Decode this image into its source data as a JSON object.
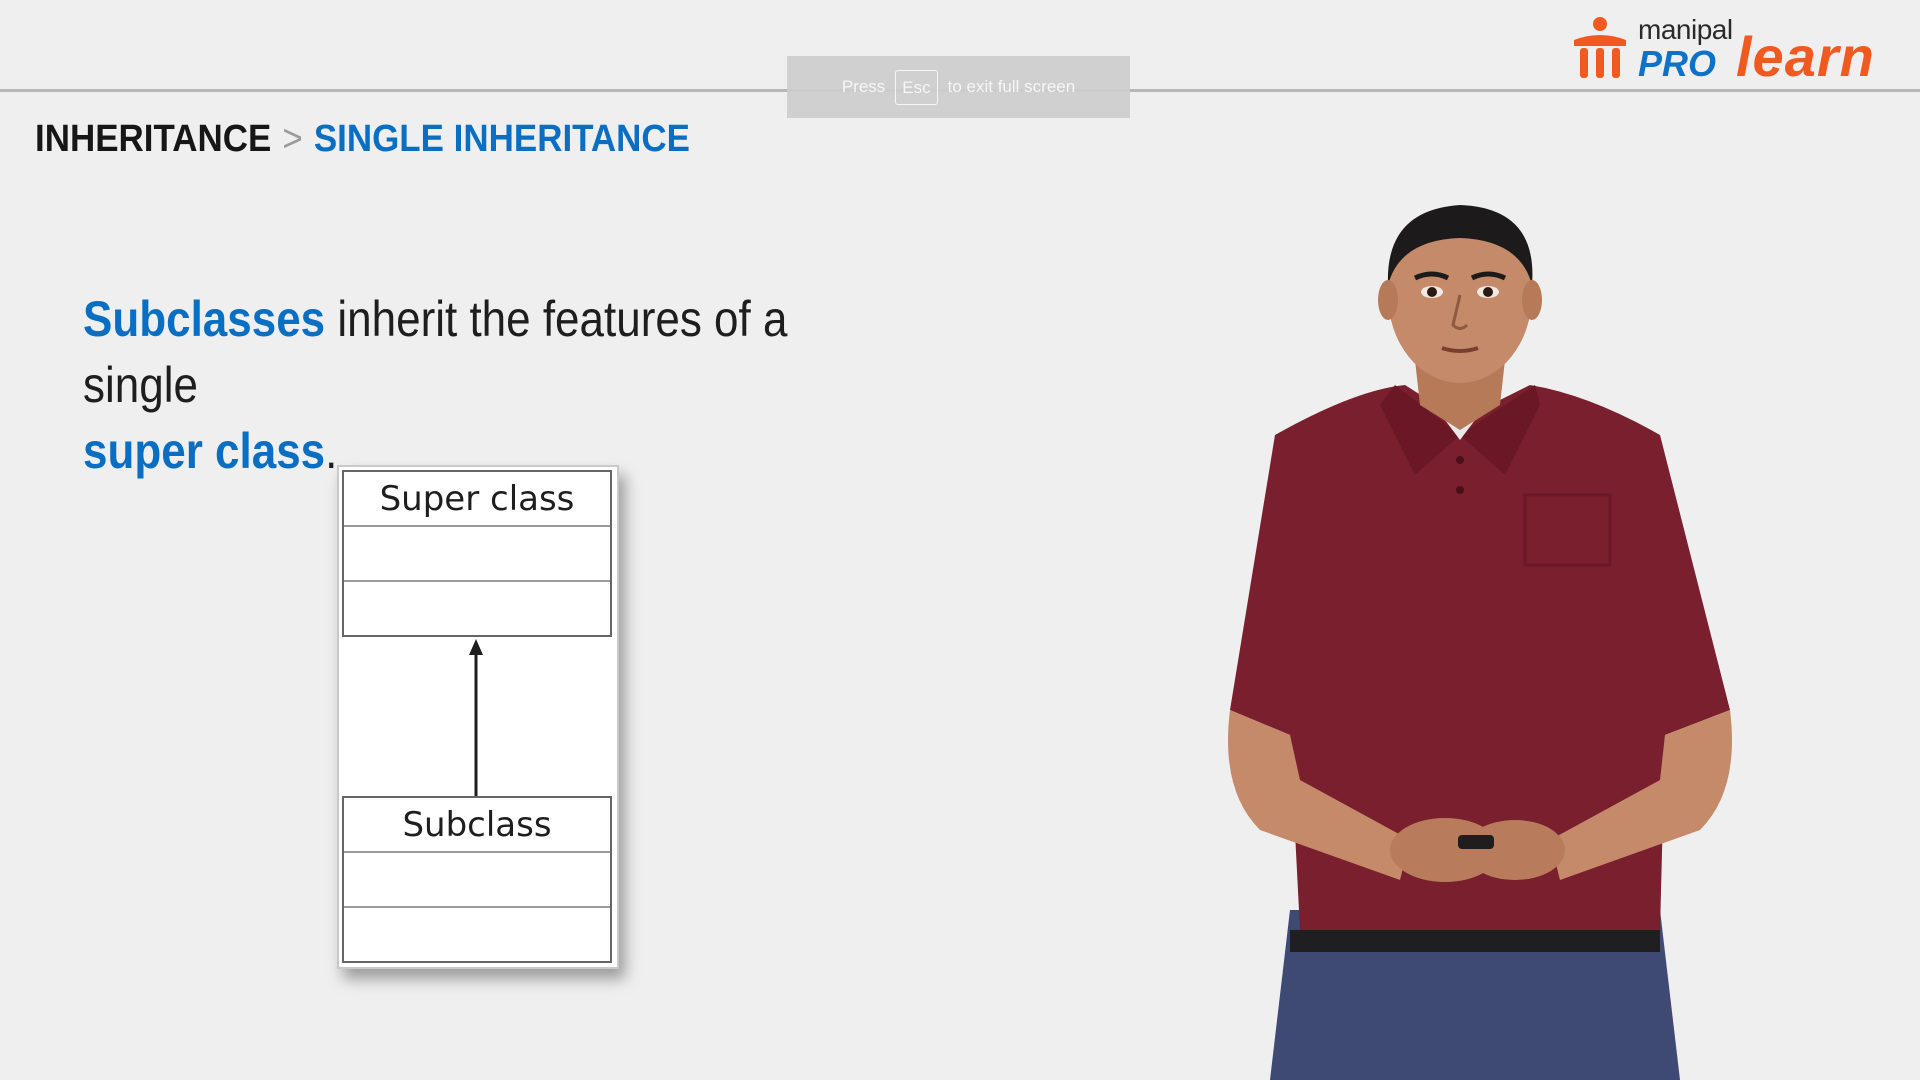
{
  "fullscreen_notice": {
    "prefix": "Press",
    "key": "Esc",
    "suffix": "to exit full screen"
  },
  "brand": {
    "top": "manipal",
    "pro": "PRO",
    "learn": "learn"
  },
  "breadcrumb": {
    "parent": "INHERITANCE",
    "separator": ">",
    "current": "SINGLE INHERITANCE"
  },
  "headline": {
    "highlight1": "Subclasses",
    "text1": " inherit the features of a single",
    "highlight2": "super class",
    "text2": "."
  },
  "diagram": {
    "super_label": "Super class",
    "sub_label": "Subclass"
  },
  "colors": {
    "accent_blue": "#0a6fc2",
    "brand_orange": "#f05a21",
    "shirt": "#7a1f2e"
  }
}
